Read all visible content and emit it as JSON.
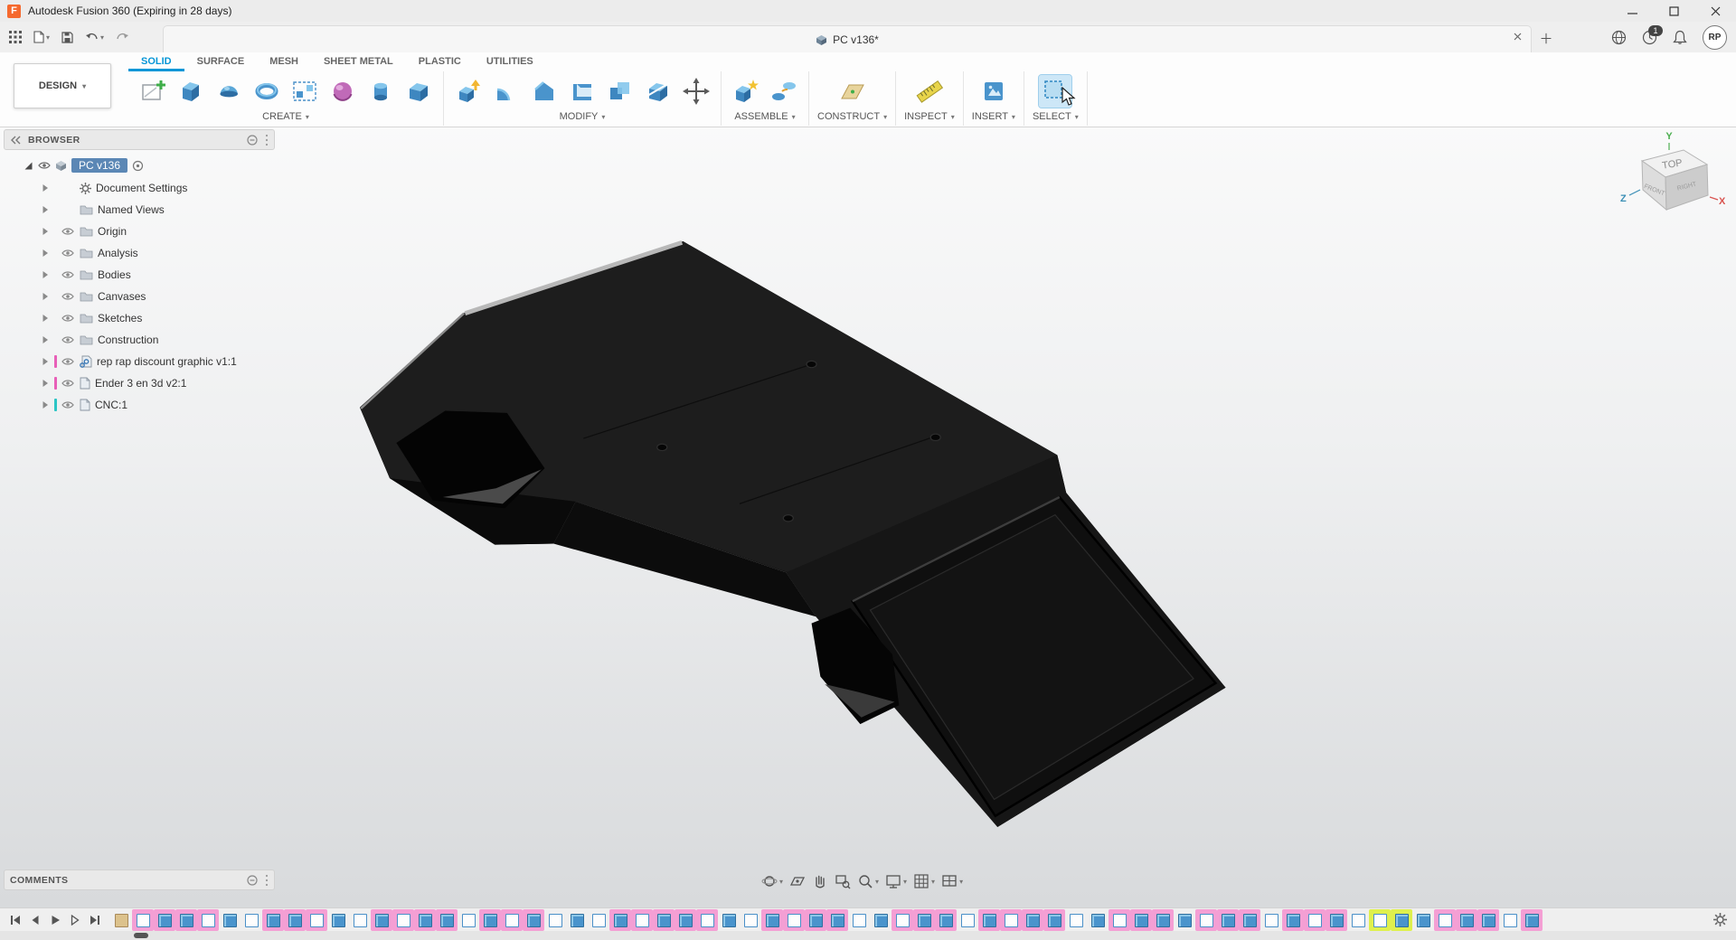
{
  "window": {
    "title": "Autodesk Fusion 360 (Expiring in 28 days)"
  },
  "tabbar": {
    "document_tab": "PC v136*",
    "notification_count": "1",
    "user_initials": "RP"
  },
  "ribbon": {
    "design_label": "DESIGN",
    "tabs": [
      {
        "label": "SOLID",
        "state": "active"
      },
      {
        "label": "SURFACE"
      },
      {
        "label": "MESH"
      },
      {
        "label": "SHEET METAL"
      },
      {
        "label": "PLASTIC"
      },
      {
        "label": "UTILITIES"
      }
    ],
    "groups": [
      {
        "label": "CREATE"
      },
      {
        "label": "MODIFY"
      },
      {
        "label": "ASSEMBLE"
      },
      {
        "label": "CONSTRUCT"
      },
      {
        "label": "INSPECT"
      },
      {
        "label": "INSERT"
      },
      {
        "label": "SELECT"
      }
    ]
  },
  "browser": {
    "title": "BROWSER",
    "root_label": "PC v136",
    "items": [
      {
        "label": "Document Settings",
        "icon": "i-gear",
        "eye": "e-no",
        "bar": "b-none"
      },
      {
        "label": "Named Views",
        "icon": "i-folder",
        "eye": "e-no",
        "bar": "b-none"
      },
      {
        "label": "Origin",
        "icon": "i-folder",
        "eye": "e-yes",
        "bar": "b-none"
      },
      {
        "label": "Analysis",
        "icon": "i-folder",
        "eye": "e-yes",
        "bar": "b-none"
      },
      {
        "label": "Bodies",
        "icon": "i-folder",
        "eye": "e-yes",
        "bar": "b-none"
      },
      {
        "label": "Canvases",
        "icon": "i-folder",
        "eye": "e-yes",
        "bar": "b-none"
      },
      {
        "label": "Sketches",
        "icon": "i-folder",
        "eye": "e-yes",
        "bar": "b-none"
      },
      {
        "label": "Construction",
        "icon": "i-folder",
        "eye": "e-yes",
        "bar": "b-none"
      },
      {
        "label": "rep rap discount graphic v1:1",
        "icon": "i-doclink",
        "eye": "e-yes",
        "bar": "b-pink"
      },
      {
        "label": "Ender 3 en 3d v2:1",
        "icon": "i-doc",
        "eye": "e-yes",
        "bar": "b-pink"
      },
      {
        "label": "CNC:1",
        "icon": "i-doc",
        "eye": "e-yes",
        "bar": "b-teal"
      }
    ]
  },
  "viewcube": {
    "top": "TOP",
    "front": "FRONT",
    "right": "RIGHT",
    "axis_x": "X",
    "axis_y": "Y",
    "axis_z": "Z"
  },
  "comments": {
    "title": "COMMENTS"
  },
  "timeline": {
    "items": [
      {
        "t": "tc",
        "h": "h0"
      },
      {
        "t": "ts",
        "h": "hp"
      },
      {
        "t": "te",
        "h": "hp"
      },
      {
        "t": "te",
        "h": "hp"
      },
      {
        "t": "ts",
        "h": "hp"
      },
      {
        "t": "te",
        "h": "h0"
      },
      {
        "t": "ts",
        "h": "h0"
      },
      {
        "t": "te",
        "h": "hp"
      },
      {
        "t": "te",
        "h": "hp"
      },
      {
        "t": "ts",
        "h": "hp"
      },
      {
        "t": "te",
        "h": "h0"
      },
      {
        "t": "ts",
        "h": "h0"
      },
      {
        "t": "te",
        "h": "hp"
      },
      {
        "t": "ts",
        "h": "hp"
      },
      {
        "t": "te",
        "h": "hp"
      },
      {
        "t": "te",
        "h": "hp"
      },
      {
        "t": "ts",
        "h": "h0"
      },
      {
        "t": "te",
        "h": "hp"
      },
      {
        "t": "ts",
        "h": "hp"
      },
      {
        "t": "te",
        "h": "hp"
      },
      {
        "t": "ts",
        "h": "h0"
      },
      {
        "t": "te",
        "h": "h0"
      },
      {
        "t": "ts",
        "h": "h0"
      },
      {
        "t": "te",
        "h": "hp"
      },
      {
        "t": "ts",
        "h": "hp"
      },
      {
        "t": "te",
        "h": "hp"
      },
      {
        "t": "te",
        "h": "hp"
      },
      {
        "t": "ts",
        "h": "hp"
      },
      {
        "t": "te",
        "h": "h0"
      },
      {
        "t": "ts",
        "h": "h0"
      },
      {
        "t": "te",
        "h": "hp"
      },
      {
        "t": "ts",
        "h": "hp"
      },
      {
        "t": "te",
        "h": "hp"
      },
      {
        "t": "te",
        "h": "hp"
      },
      {
        "t": "ts",
        "h": "h0"
      },
      {
        "t": "te",
        "h": "h0"
      },
      {
        "t": "ts",
        "h": "hp"
      },
      {
        "t": "te",
        "h": "hp"
      },
      {
        "t": "te",
        "h": "hp"
      },
      {
        "t": "ts",
        "h": "h0"
      },
      {
        "t": "te",
        "h": "hp"
      },
      {
        "t": "ts",
        "h": "hp"
      },
      {
        "t": "te",
        "h": "hp"
      },
      {
        "t": "te",
        "h": "hp"
      },
      {
        "t": "ts",
        "h": "h0"
      },
      {
        "t": "te",
        "h": "h0"
      },
      {
        "t": "ts",
        "h": "hp"
      },
      {
        "t": "te",
        "h": "hp"
      },
      {
        "t": "te",
        "h": "hp"
      },
      {
        "t": "te",
        "h": "h0"
      },
      {
        "t": "ts",
        "h": "hp"
      },
      {
        "t": "te",
        "h": "hp"
      },
      {
        "t": "te",
        "h": "hp"
      },
      {
        "t": "ts",
        "h": "h0"
      },
      {
        "t": "te",
        "h": "hp"
      },
      {
        "t": "ts",
        "h": "hp"
      },
      {
        "t": "te",
        "h": "hp"
      },
      {
        "t": "ts",
        "h": "h0"
      },
      {
        "t": "ts",
        "h": "hy"
      },
      {
        "t": "te",
        "h": "hy"
      },
      {
        "t": "te",
        "h": "h0"
      },
      {
        "t": "ts",
        "h": "hp"
      },
      {
        "t": "te",
        "h": "hp"
      },
      {
        "t": "te",
        "h": "hp"
      },
      {
        "t": "ts",
        "h": "h0"
      },
      {
        "t": "te",
        "h": "hp"
      }
    ]
  },
  "colors": {
    "accent_blue": "#0696d7",
    "selection_pink": "#f49fd4",
    "selection_yellow": "#dff04d",
    "link_pink_bar": "#e85fb8",
    "link_teal_bar": "#2cc5c5"
  }
}
